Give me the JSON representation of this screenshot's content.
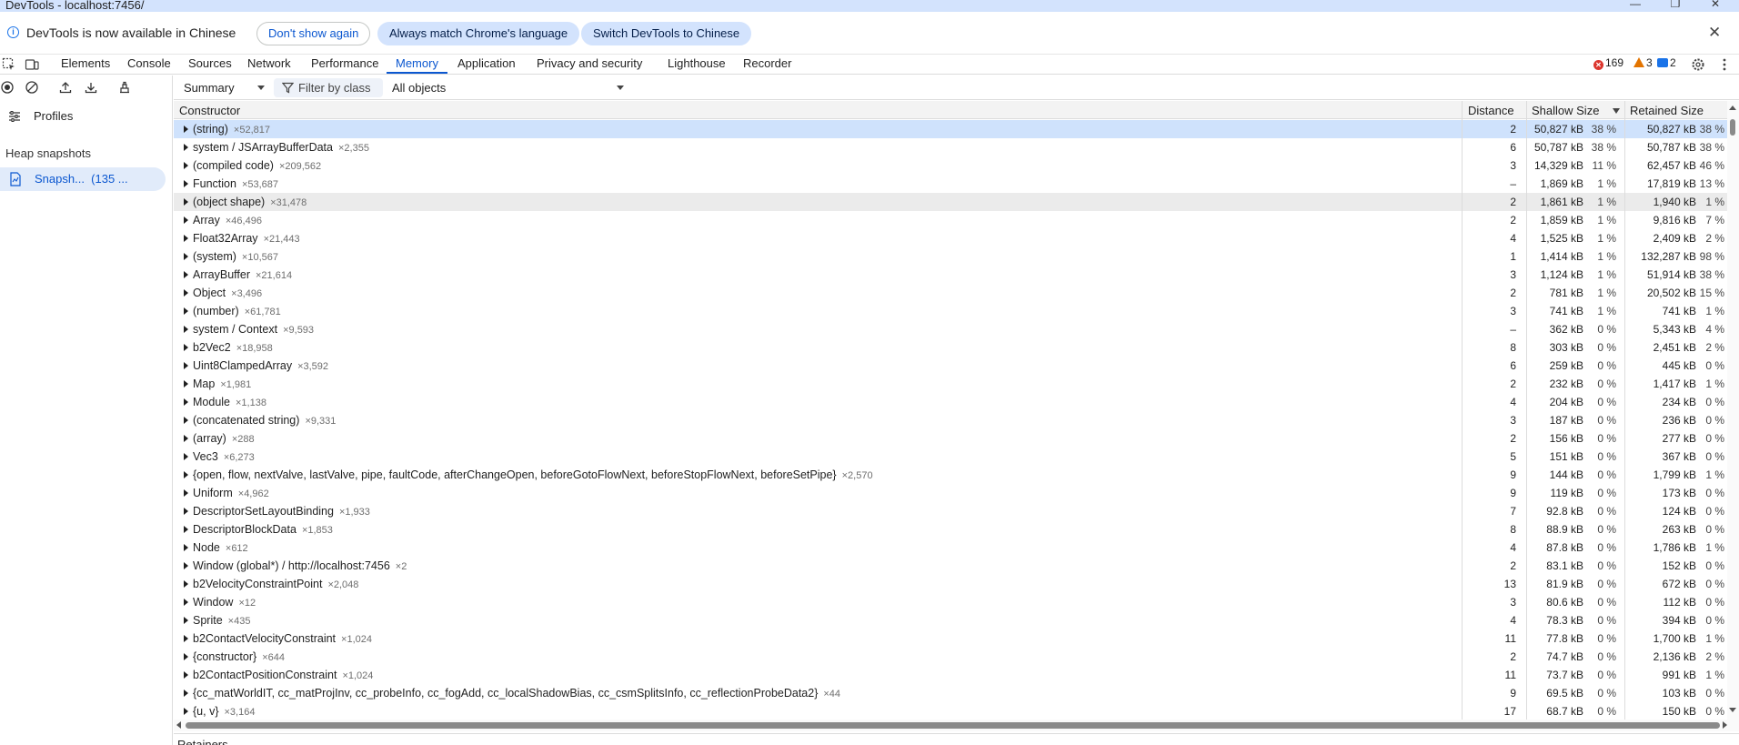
{
  "window": {
    "title": "DevTools - localhost:7456/"
  },
  "infobar": {
    "message": "DevTools is now available in Chinese",
    "dont_show": "Don't show again",
    "always_match": "Always match Chrome's language",
    "switch_chinese": "Switch DevTools to Chinese"
  },
  "tabs": [
    "Elements",
    "Console",
    "Sources",
    "Network",
    "Performance",
    "Memory",
    "Application",
    "Privacy and security",
    "Lighthouse",
    "Recorder"
  ],
  "active_tab": "Memory",
  "badges": {
    "errors": "169",
    "warnings": "3",
    "messages": "2"
  },
  "sidebar": {
    "profiles": "Profiles",
    "heap_snapshots": "Heap snapshots",
    "snapshot_label": "Snapsh...",
    "snapshot_size": "(135 ..."
  },
  "toolbar": {
    "view": "Summary",
    "filter": "Filter by class",
    "objects": "All objects"
  },
  "columns": {
    "constructor": "Constructor",
    "distance": "Distance",
    "shallow": "Shallow Size",
    "retained": "Retained Size"
  },
  "rows": [
    {
      "name": "(string)",
      "count": "×52,817",
      "distance": "2",
      "shallow": "50,827 kB",
      "shallow_pct": "38 %",
      "retained": "50,827 kB",
      "retained_pct": "38 %"
    },
    {
      "name": "system / JSArrayBufferData",
      "count": "×2,355",
      "distance": "6",
      "shallow": "50,787 kB",
      "shallow_pct": "38 %",
      "retained": "50,787 kB",
      "retained_pct": "38 %"
    },
    {
      "name": "(compiled code)",
      "count": "×209,562",
      "distance": "3",
      "shallow": "14,329 kB",
      "shallow_pct": "11 %",
      "retained": "62,457 kB",
      "retained_pct": "46 %"
    },
    {
      "name": "Function",
      "count": "×53,687",
      "distance": "–",
      "shallow": "1,869 kB",
      "shallow_pct": "1 %",
      "retained": "17,819 kB",
      "retained_pct": "13 %"
    },
    {
      "name": "(object shape)",
      "count": "×31,478",
      "distance": "2",
      "shallow": "1,861 kB",
      "shallow_pct": "1 %",
      "retained": "1,940 kB",
      "retained_pct": "1 %"
    },
    {
      "name": "Array",
      "count": "×46,496",
      "distance": "2",
      "shallow": "1,859 kB",
      "shallow_pct": "1 %",
      "retained": "9,816 kB",
      "retained_pct": "7 %"
    },
    {
      "name": "Float32Array",
      "count": "×21,443",
      "distance": "4",
      "shallow": "1,525 kB",
      "shallow_pct": "1 %",
      "retained": "2,409 kB",
      "retained_pct": "2 %"
    },
    {
      "name": "(system)",
      "count": "×10,567",
      "distance": "1",
      "shallow": "1,414 kB",
      "shallow_pct": "1 %",
      "retained": "132,287 kB",
      "retained_pct": "98 %"
    },
    {
      "name": "ArrayBuffer",
      "count": "×21,614",
      "distance": "3",
      "shallow": "1,124 kB",
      "shallow_pct": "1 %",
      "retained": "51,914 kB",
      "retained_pct": "38 %"
    },
    {
      "name": "Object",
      "count": "×3,496",
      "distance": "2",
      "shallow": "781 kB",
      "shallow_pct": "1 %",
      "retained": "20,502 kB",
      "retained_pct": "15 %"
    },
    {
      "name": "(number)",
      "count": "×61,781",
      "distance": "3",
      "shallow": "741 kB",
      "shallow_pct": "1 %",
      "retained": "741 kB",
      "retained_pct": "1 %"
    },
    {
      "name": "system / Context",
      "count": "×9,593",
      "distance": "–",
      "shallow": "362 kB",
      "shallow_pct": "0 %",
      "retained": "5,343 kB",
      "retained_pct": "4 %"
    },
    {
      "name": "b2Vec2",
      "count": "×18,958",
      "distance": "8",
      "shallow": "303 kB",
      "shallow_pct": "0 %",
      "retained": "2,451 kB",
      "retained_pct": "2 %"
    },
    {
      "name": "Uint8ClampedArray",
      "count": "×3,592",
      "distance": "6",
      "shallow": "259 kB",
      "shallow_pct": "0 %",
      "retained": "445 kB",
      "retained_pct": "0 %"
    },
    {
      "name": "Map",
      "count": "×1,981",
      "distance": "2",
      "shallow": "232 kB",
      "shallow_pct": "0 %",
      "retained": "1,417 kB",
      "retained_pct": "1 %"
    },
    {
      "name": "Module",
      "count": "×1,138",
      "distance": "4",
      "shallow": "204 kB",
      "shallow_pct": "0 %",
      "retained": "234 kB",
      "retained_pct": "0 %"
    },
    {
      "name": "(concatenated string)",
      "count": "×9,331",
      "distance": "3",
      "shallow": "187 kB",
      "shallow_pct": "0 %",
      "retained": "236 kB",
      "retained_pct": "0 %"
    },
    {
      "name": "(array)",
      "count": "×288",
      "distance": "2",
      "shallow": "156 kB",
      "shallow_pct": "0 %",
      "retained": "277 kB",
      "retained_pct": "0 %"
    },
    {
      "name": "Vec3",
      "count": "×6,273",
      "distance": "5",
      "shallow": "151 kB",
      "shallow_pct": "0 %",
      "retained": "367 kB",
      "retained_pct": "0 %"
    },
    {
      "name": "{open, flow, nextValve, lastValve, pipe, faultCode, afterChangeOpen, beforeGotoFlowNext, beforeStopFlowNext, beforeSetPipe}",
      "count": "×2,570",
      "distance": "9",
      "shallow": "144 kB",
      "shallow_pct": "0 %",
      "retained": "1,799 kB",
      "retained_pct": "1 %"
    },
    {
      "name": "Uniform",
      "count": "×4,962",
      "distance": "9",
      "shallow": "119 kB",
      "shallow_pct": "0 %",
      "retained": "173 kB",
      "retained_pct": "0 %"
    },
    {
      "name": "DescriptorSetLayoutBinding",
      "count": "×1,933",
      "distance": "7",
      "shallow": "92.8 kB",
      "shallow_pct": "0 %",
      "retained": "124 kB",
      "retained_pct": "0 %"
    },
    {
      "name": "DescriptorBlockData",
      "count": "×1,853",
      "distance": "8",
      "shallow": "88.9 kB",
      "shallow_pct": "0 %",
      "retained": "263 kB",
      "retained_pct": "0 %"
    },
    {
      "name": "Node",
      "count": "×612",
      "distance": "4",
      "shallow": "87.8 kB",
      "shallow_pct": "0 %",
      "retained": "1,786 kB",
      "retained_pct": "1 %"
    },
    {
      "name": "Window (global*) / http://localhost:7456",
      "count": "×2",
      "distance": "2",
      "shallow": "83.1 kB",
      "shallow_pct": "0 %",
      "retained": "152 kB",
      "retained_pct": "0 %"
    },
    {
      "name": "b2VelocityConstraintPoint",
      "count": "×2,048",
      "distance": "13",
      "shallow": "81.9 kB",
      "shallow_pct": "0 %",
      "retained": "672 kB",
      "retained_pct": "0 %"
    },
    {
      "name": "Window",
      "count": "×12",
      "distance": "3",
      "shallow": "80.6 kB",
      "shallow_pct": "0 %",
      "retained": "112 kB",
      "retained_pct": "0 %"
    },
    {
      "name": "Sprite",
      "count": "×435",
      "distance": "4",
      "shallow": "78.3 kB",
      "shallow_pct": "0 %",
      "retained": "394 kB",
      "retained_pct": "0 %"
    },
    {
      "name": "b2ContactVelocityConstraint",
      "count": "×1,024",
      "distance": "11",
      "shallow": "77.8 kB",
      "shallow_pct": "0 %",
      "retained": "1,700 kB",
      "retained_pct": "1 %"
    },
    {
      "name": "{constructor}",
      "count": "×644",
      "distance": "2",
      "shallow": "74.7 kB",
      "shallow_pct": "0 %",
      "retained": "2,136 kB",
      "retained_pct": "2 %"
    },
    {
      "name": "b2ContactPositionConstraint",
      "count": "×1,024",
      "distance": "11",
      "shallow": "73.7 kB",
      "shallow_pct": "0 %",
      "retained": "991 kB",
      "retained_pct": "1 %"
    },
    {
      "name": "{cc_matWorldIT, cc_matProjInv, cc_probeInfo, cc_fogAdd, cc_localShadowBias, cc_csmSplitsInfo, cc_reflectionProbeData2}",
      "count": "×44",
      "distance": "9",
      "shallow": "69.5 kB",
      "shallow_pct": "0 %",
      "retained": "103 kB",
      "retained_pct": "0 %"
    },
    {
      "name": "{u, v}",
      "count": "×3,164",
      "distance": "17",
      "shallow": "68.7 kB",
      "shallow_pct": "0 %",
      "retained": "150 kB",
      "retained_pct": "0 %"
    }
  ],
  "retainers": "Retainers"
}
